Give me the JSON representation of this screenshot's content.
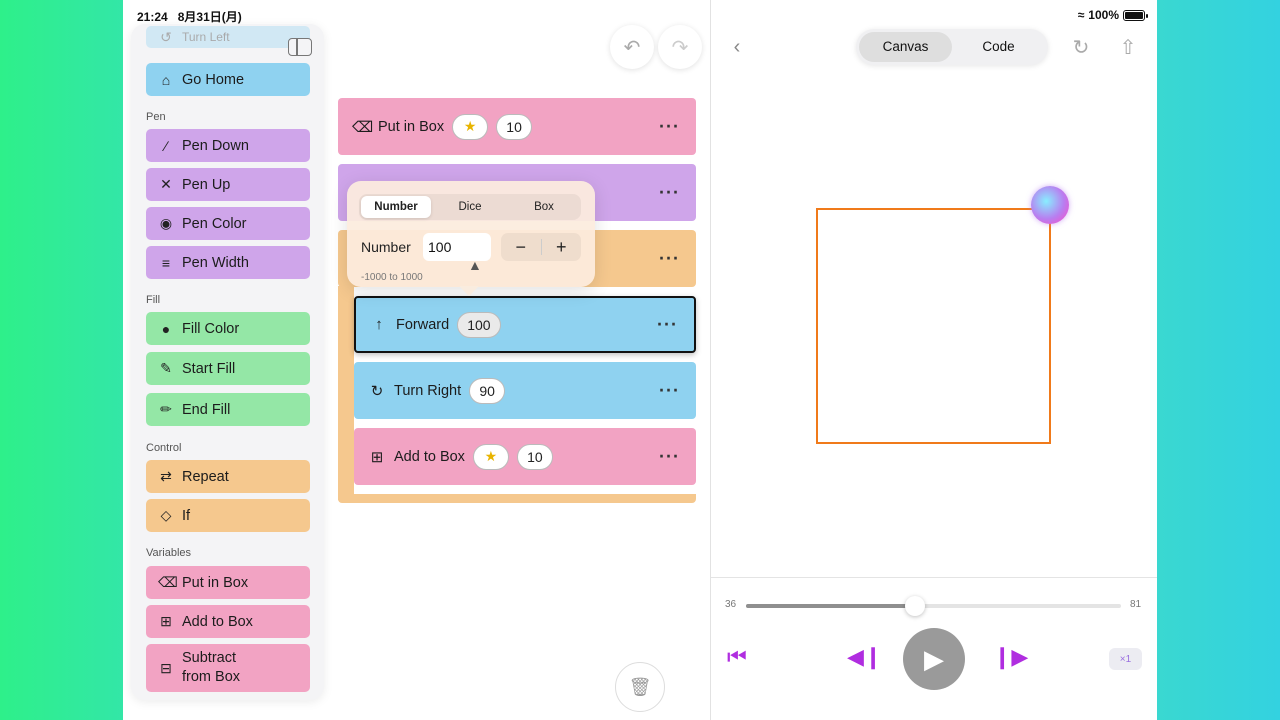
{
  "status_bar": {
    "time": "21:24",
    "date": "8月31日(月)",
    "battery": "100%"
  },
  "palette": {
    "top_faded_item": "Turn Left",
    "go_home": "Go Home",
    "sections": {
      "pen": "Pen",
      "fill": "Fill",
      "control": "Control",
      "variables": "Variables"
    },
    "pen_items": [
      "Pen Down",
      "Pen Up",
      "Pen Color",
      "Pen Width"
    ],
    "fill_items": [
      "Fill Color",
      "Start Fill",
      "End Fill"
    ],
    "control_items": [
      "Repeat",
      "If"
    ],
    "variable_items": [
      "Put in Box",
      "Add to Box",
      "Subtract from Box"
    ]
  },
  "editor": {
    "put_in_box": {
      "label": "Put in Box",
      "value": "10"
    },
    "forward": {
      "label": "Forward",
      "value": "100"
    },
    "turn_right": {
      "label": "Turn Right",
      "value": "90"
    },
    "add_to_box": {
      "label": "Add to Box",
      "value": "10"
    },
    "more": "···"
  },
  "popover": {
    "tabs": [
      "Number",
      "Dice",
      "Box"
    ],
    "active_tab": "Number",
    "field_label": "Number",
    "field_value": "100",
    "minus": "−",
    "plus": "+",
    "range_hint": "-1000 to 1000"
  },
  "canvas_panel": {
    "tabs": [
      "Canvas",
      "Code"
    ],
    "active_tab": "Canvas",
    "step_start": "36",
    "step_end": "81",
    "progress": 0.45,
    "speed": "×1",
    "pen_color": "#f07a1a"
  },
  "colors": {
    "motion": "#8fd2f0",
    "pen": "#cfa5ea",
    "fill": "#94e7a6",
    "control": "#f5c88e",
    "variables": "#f2a3c3",
    "player_accent": "#b02de0"
  }
}
